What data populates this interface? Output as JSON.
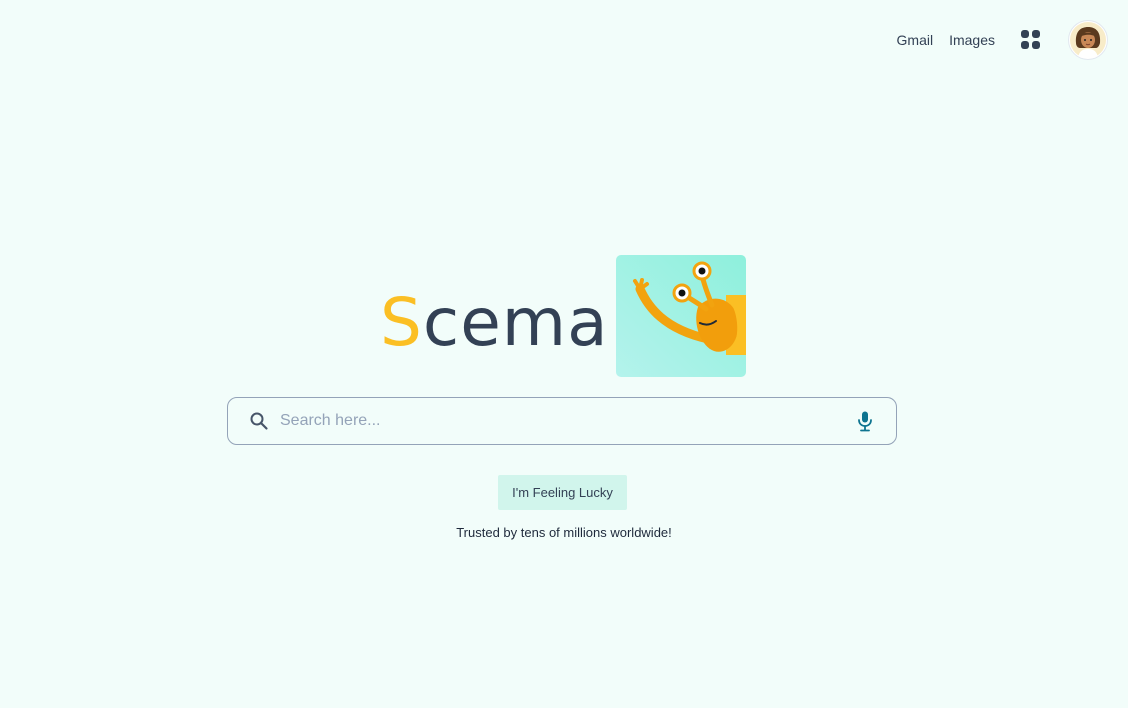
{
  "header": {
    "gmail_label": "Gmail",
    "images_label": "Images",
    "apps_icon": "apps-grid-icon",
    "avatar_icon": "user-avatar"
  },
  "logo": {
    "first_letter": "S",
    "rest": "cema",
    "mascot_icon": "snail-mascot"
  },
  "search": {
    "placeholder": "Search here...",
    "value": "",
    "search_icon": "search-icon",
    "mic_icon": "microphone-icon"
  },
  "lucky_button_label": "I'm Feeling Lucky",
  "tagline": "Trusted by tens of millions worldwide!",
  "colors": {
    "background": "#f2fdfa",
    "text": "#334155",
    "accent_yellow": "#fbbf24",
    "accent_teal": "#0e7490",
    "button_bg": "#d1f5ec"
  }
}
